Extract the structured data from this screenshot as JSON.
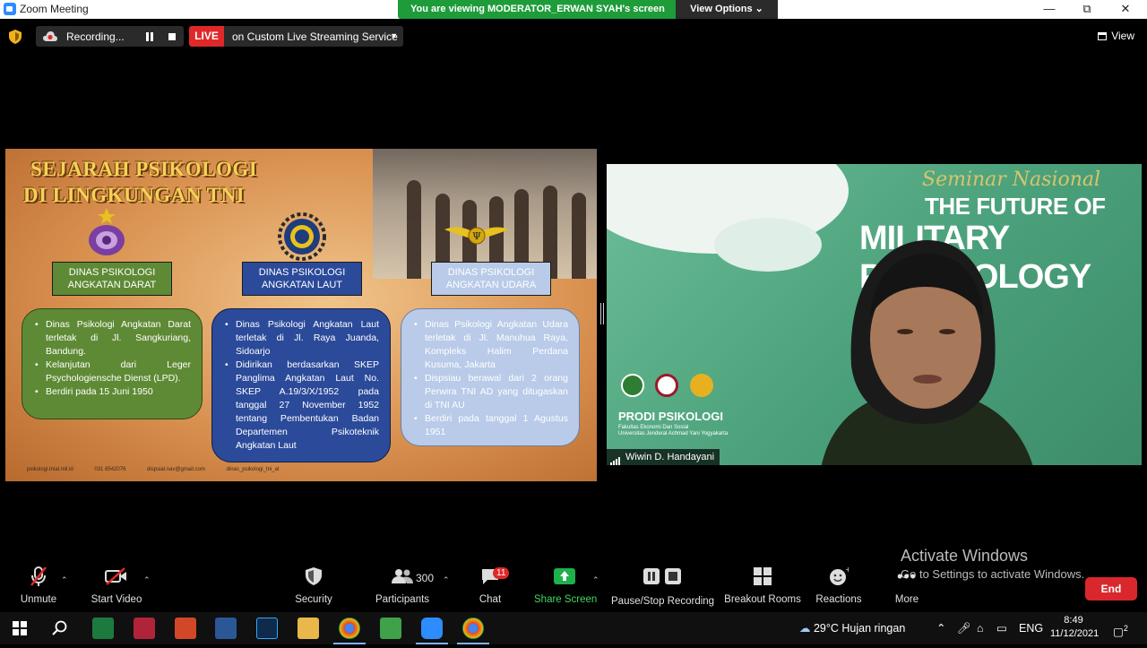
{
  "window": {
    "title": "Zoom Meeting",
    "minimize": "—",
    "maximize": "⧉",
    "close": "✕"
  },
  "banner": {
    "viewing_text": "You are viewing MODERATOR_ERWAN SYAH's screen",
    "view_options": "View Options"
  },
  "topbar": {
    "recording_label": "Recording...",
    "live_badge": "LIVE",
    "live_label": "on Custom Live Streaming Service",
    "view_label": "View"
  },
  "slide": {
    "title_line1": "SEJARAH PSIKOLOGI",
    "title_line2": "DI LINGKUNGAN TNI",
    "labels": [
      {
        "line1": "DINAS PSIKOLOGI",
        "line2": "ANGKATAN DARAT"
      },
      {
        "line1": "DINAS PSIKOLOGI",
        "line2": "ANGKATAN LAUT"
      },
      {
        "line1": "DINAS PSIKOLOGI",
        "line2": "ANGKATAN UDARA"
      }
    ],
    "boxes": [
      {
        "items": [
          "Dinas Psikologi Angkatan Darat terletak di Jl. Sangkuriang, Bandung.",
          "Kelanjutan dari Leger Psychologiensche Dienst (LPD).",
          "Berdiri pada 15 Juni 1950"
        ]
      },
      {
        "items": [
          "Dinas Psikologi Angkatan Laut terletak di Jl. Raya Juanda, Sidoarjo",
          "Didirikan berdasarkan SKEP Panglima Angkatan Laut No. SKEP A.19/3/X/1952 pada tanggal 27 November 1952 tentang Pembentukan Badan Departemen Psikoteknik Angkatan Laut"
        ]
      },
      {
        "items": [
          "Dinas Psikologi Angkatan Udara terletak di Jl. Manuhua Raya, Kompleks Halim Perdana Kusuma, Jakarta",
          "Dispsiau berawal dari 2 orang Perwira TNI AD yang ditugaskan di TNI AU",
          "Berdiri pada tanggal 1 Agustus 1951"
        ]
      }
    ],
    "footer": [
      "psikologi.tnial.mil.id",
      "031 8542076",
      "dispsial.nav@gmail.com",
      "dinas_psikologi_tni_al"
    ]
  },
  "video": {
    "seminar": "Seminar Nasional",
    "future": "THE FUTURE OF",
    "military": "MILITARY PSYCHOLOGY",
    "prodi": "PRODI PSIKOLOGI",
    "fakultas": "Fakultas Ekonomi Dan Sosial",
    "universitas": "Universitas Jenderal Achmad Yani Yogyakarta",
    "participant_name": "Wiwin D. Handayani"
  },
  "toolbar": {
    "unmute": "Unmute",
    "start_video": "Start Video",
    "security": "Security",
    "participants": "Participants",
    "participants_count": "300",
    "chat": "Chat",
    "chat_badge": "11",
    "share_screen": "Share Screen",
    "pause_recording": "Pause/Stop Recording",
    "breakout_rooms": "Breakout Rooms",
    "reactions": "Reactions",
    "more": "More",
    "end": "End"
  },
  "activate": {
    "line1": "Activate Windows",
    "line2": "Go to Settings to activate Windows."
  },
  "taskbar": {
    "weather": "29°C  Hujan ringan",
    "language": "ENG",
    "time": "8:49",
    "date": "11/12/2021",
    "notif_count": "2"
  },
  "colors": {
    "share_green": "#1e9c3a",
    "live_red": "#e02828",
    "end_red": "#d9272e",
    "slide_title": "#f4d255"
  }
}
